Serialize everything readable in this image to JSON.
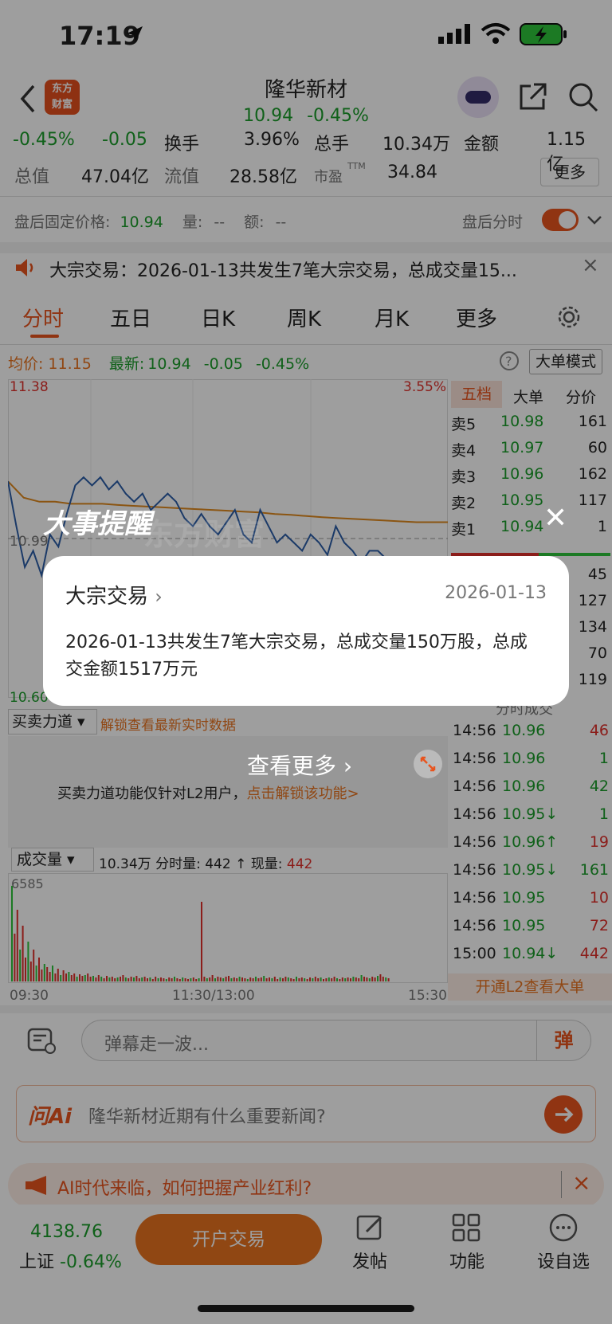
{
  "status_bar": {
    "time": "17:19"
  },
  "header": {
    "logo_line1": "东方",
    "logo_line2": "财富",
    "stock_name": "隆华新材",
    "price": "10.94",
    "change_pct": "-0.45%"
  },
  "stats": {
    "row1": {
      "pct": "-0.45%",
      "chg": "-0.05",
      "turnover_label": "换手",
      "turnover": "3.96%",
      "vol_label": "总手",
      "vol": "10.34万",
      "amount_label": "金额",
      "amount": "1.15亿"
    },
    "row2": {
      "mktcap_label": "总值",
      "mktcap": "47.04亿",
      "float_label": "流值",
      "float": "28.58亿",
      "pe_label": "市盈",
      "pe_sup": "TTM",
      "pe": "34.84",
      "more": "更多"
    }
  },
  "after_hours": {
    "label": "盘后固定价格:",
    "price": "10.94",
    "vol_label": "量:",
    "vol": "--",
    "amt_label": "额:",
    "amt": "--",
    "toggle_label": "盘后分时"
  },
  "notice": {
    "text": "大宗交易：2026-01-13共发生7笔大宗交易，总成交量15...",
    "close": "×"
  },
  "tabs": [
    "分时",
    "五日",
    "日K",
    "周K",
    "月K",
    "更多"
  ],
  "chart_info": {
    "avg_label": "均价:",
    "avg": "11.15",
    "last_label": "最新:",
    "last": "10.94",
    "chg": "-0.05",
    "pct": "-0.45%",
    "mode": "大单模式"
  },
  "chart_data": {
    "type": "line",
    "ylim": [
      10.6,
      11.38
    ],
    "y_tick_labels": [
      "11.38",
      "10.99",
      "10.60"
    ],
    "right_tick_label": "3.55%",
    "x_tick_labels": [
      "09:30",
      "11:30/13:00",
      "15:30"
    ],
    "series": [
      {
        "values": [
          11.13,
          11.02,
          10.92,
          10.96,
          10.9,
          11.0,
          10.97,
          11.05,
          11.12,
          11.14,
          11.12,
          11.14,
          11.11,
          11.13,
          11.1,
          11.08,
          11.1,
          11.06,
          11.08,
          11.1,
          11.08,
          11.04,
          11.02,
          11.05,
          11.02,
          11.0,
          11.03,
          11.06,
          11.0,
          10.98,
          11.06,
          11.02,
          10.98,
          11.0,
          10.98,
          10.96,
          11.0,
          10.98,
          10.95,
          11.02,
          10.98,
          10.96,
          10.93,
          10.96,
          10.96,
          10.94
        ]
      },
      {
        "values": [
          11.13,
          11.09,
          11.08,
          11.08,
          11.075,
          11.075,
          11.075,
          11.072,
          11.07,
          11.068,
          11.066,
          11.064,
          11.062,
          11.06,
          11.058,
          11.056,
          11.054,
          11.05,
          11.048,
          11.045,
          11.042,
          11.04,
          11.038,
          11.036,
          11.034,
          11.032,
          11.03,
          11.03,
          11.03
        ]
      }
    ]
  },
  "order_book": {
    "tabs": [
      "五档",
      "大单",
      "分价"
    ],
    "asks": [
      {
        "label": "卖5",
        "price": "10.98",
        "vol": "161"
      },
      {
        "label": "卖4",
        "price": "10.97",
        "vol": "60"
      },
      {
        "label": "卖3",
        "price": "10.96",
        "vol": "162"
      },
      {
        "label": "卖2",
        "price": "10.95",
        "vol": "117"
      },
      {
        "label": "卖1",
        "price": "10.94",
        "vol": "1"
      }
    ],
    "bids_vol": [
      "45",
      "127",
      "134",
      "70",
      "119"
    ],
    "ticks_header": "分时成交",
    "ticks": [
      {
        "t": "14:56",
        "p": "10.96",
        "v": "46",
        "c": "red"
      },
      {
        "t": "14:56",
        "p": "10.96",
        "v": "1",
        "c": "green"
      },
      {
        "t": "14:56",
        "p": "10.96",
        "v": "42",
        "c": "green"
      },
      {
        "t": "14:56",
        "p": "10.95↓",
        "v": "1",
        "c": "green"
      },
      {
        "t": "14:56",
        "p": "10.96↑",
        "v": "19",
        "c": "red"
      },
      {
        "t": "14:56",
        "p": "10.95↓",
        "v": "161",
        "c": "green"
      },
      {
        "t": "14:56",
        "p": "10.95",
        "v": "10",
        "c": "red"
      },
      {
        "t": "14:56",
        "p": "10.95",
        "v": "72",
        "c": "red"
      },
      {
        "t": "15:00",
        "p": "10.94↓",
        "v": "442",
        "c": "red"
      }
    ],
    "l2_banner": "开通L2查看大单"
  },
  "power": {
    "label": "买卖力道",
    "unlock": "解锁查看最新实时数据",
    "msg": "买卖力道功能仅针对L2用户，",
    "msg_link": "点击解锁该功能>"
  },
  "volume": {
    "label": "成交量",
    "total": "10.34万",
    "minute_label": "分时量:",
    "minute": "442",
    "arrow": "↑",
    "cur_label": "现量:",
    "cur": "442",
    "max": "6585"
  },
  "danmaku": {
    "placeholder": "弹幕走一波...",
    "btn": "弹"
  },
  "ai": {
    "label": "问Ai",
    "question": "隆华新材近期有什么重要新闻?"
  },
  "promo": {
    "text": "AI时代来临，如何把握产业红利?",
    "close": "×"
  },
  "bottom": {
    "index_value": "4138.76",
    "index_name": "上证",
    "index_pct": "-0.64%",
    "trade_btn": "开户交易",
    "items": [
      "发帖",
      "功能",
      "设自选"
    ]
  },
  "popup": {
    "heading": "大事提醒",
    "watermark": "东方财富",
    "event_type": "大宗交易",
    "event_date": "2026-01-13",
    "event_text": "2026-01-13共发生7笔大宗交易，总成交量150万股，总成交金额1517万元",
    "see_more": "查看更多",
    "close": "✕"
  }
}
